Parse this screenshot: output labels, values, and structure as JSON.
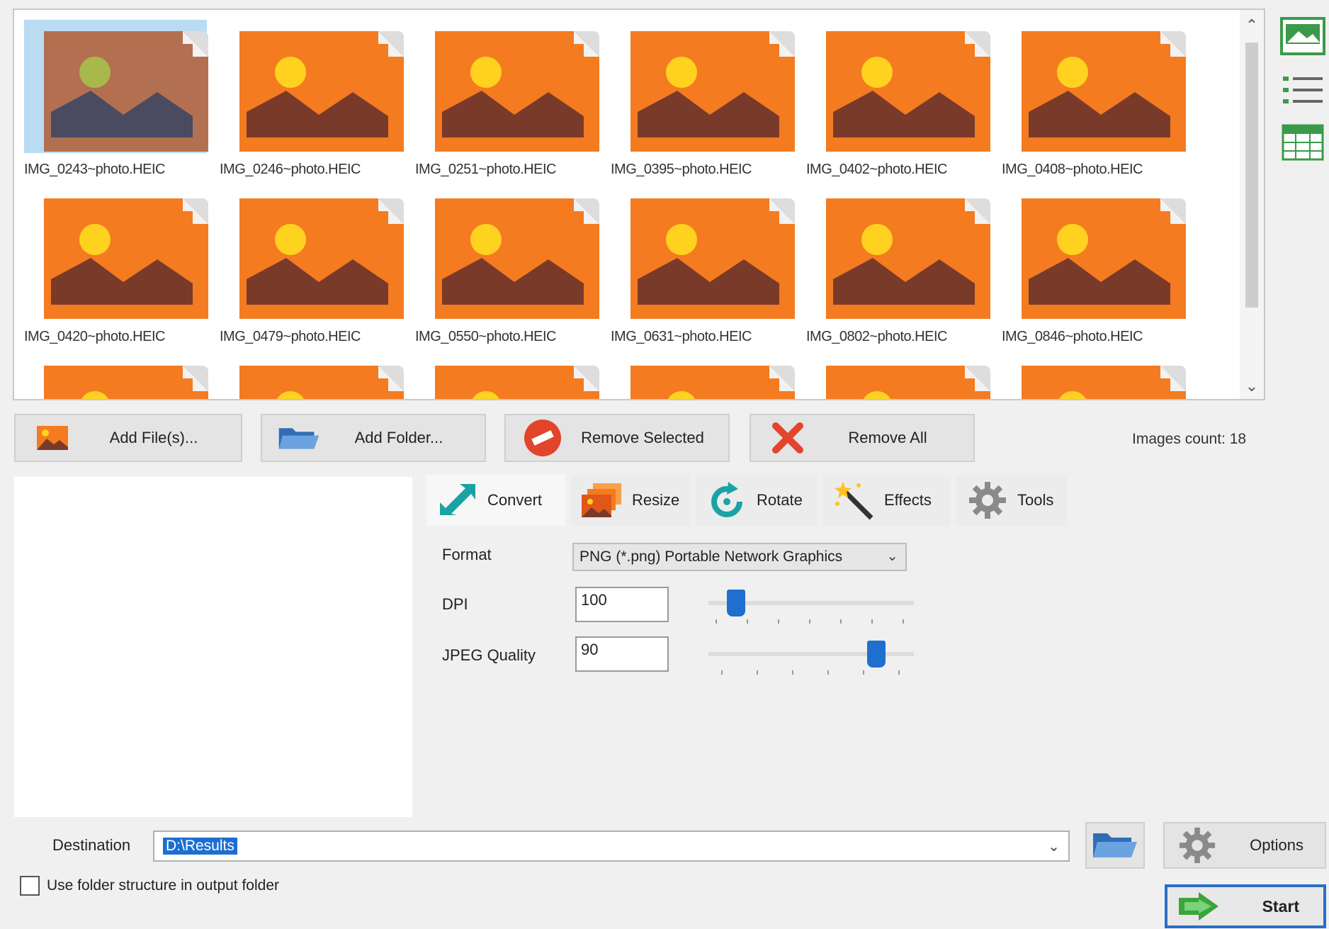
{
  "gallery": {
    "thumbnails": [
      {
        "label": "IMG_0243~photo.HEIC",
        "selected": true
      },
      {
        "label": "IMG_0246~photo.HEIC",
        "selected": false
      },
      {
        "label": "IMG_0251~photo.HEIC",
        "selected": false
      },
      {
        "label": "IMG_0395~photo.HEIC",
        "selected": false
      },
      {
        "label": "IMG_0402~photo.HEIC",
        "selected": false
      },
      {
        "label": "IMG_0408~photo.HEIC",
        "selected": false
      },
      {
        "label": "IMG_0420~photo.HEIC",
        "selected": false
      },
      {
        "label": "IMG_0479~photo.HEIC",
        "selected": false
      },
      {
        "label": "IMG_0550~photo.HEIC",
        "selected": false
      },
      {
        "label": "IMG_0631~photo.HEIC",
        "selected": false
      },
      {
        "label": "IMG_0802~photo.HEIC",
        "selected": false
      },
      {
        "label": "IMG_0846~photo.HEIC",
        "selected": false
      },
      {
        "label": "",
        "selected": false
      },
      {
        "label": "",
        "selected": false
      },
      {
        "label": "",
        "selected": false
      },
      {
        "label": "",
        "selected": false
      },
      {
        "label": "",
        "selected": false
      },
      {
        "label": "",
        "selected": false
      }
    ],
    "view_modes": [
      "thumbnails-view-icon",
      "list-view-icon",
      "table-view-icon"
    ]
  },
  "actions": {
    "add_files": "Add File(s)...",
    "add_folder": "Add Folder...",
    "remove_selected": "Remove Selected",
    "remove_all": "Remove All",
    "images_count": "Images count: 18"
  },
  "tabs": [
    {
      "label": "Convert",
      "icon": "convert-arrows-icon",
      "active": true
    },
    {
      "label": "Resize",
      "icon": "resize-icon",
      "active": false
    },
    {
      "label": "Rotate",
      "icon": "rotate-icon",
      "active": false
    },
    {
      "label": "Effects",
      "icon": "magic-wand-icon",
      "active": false
    },
    {
      "label": "Tools",
      "icon": "gear-icon",
      "active": false
    }
  ],
  "settings": {
    "format_label": "Format",
    "format_value": "PNG (*.png) Portable Network Graphics",
    "dpi_label": "DPI",
    "dpi_value": "100",
    "dpi_slider_fraction": 0.1,
    "jpeg_label": "JPEG Quality",
    "jpeg_value": "90",
    "jpeg_slider_fraction": 0.85
  },
  "destination": {
    "label": "Destination",
    "value": "D:\\Results",
    "use_folder_structure": "Use folder structure in output folder",
    "options": "Options",
    "start": "Start"
  },
  "colors": {
    "accent": "#1f6fcf",
    "thumb_orange": "#f47b20",
    "thumb_brown": "#7a3a2a",
    "sun": "#ffd21f"
  }
}
